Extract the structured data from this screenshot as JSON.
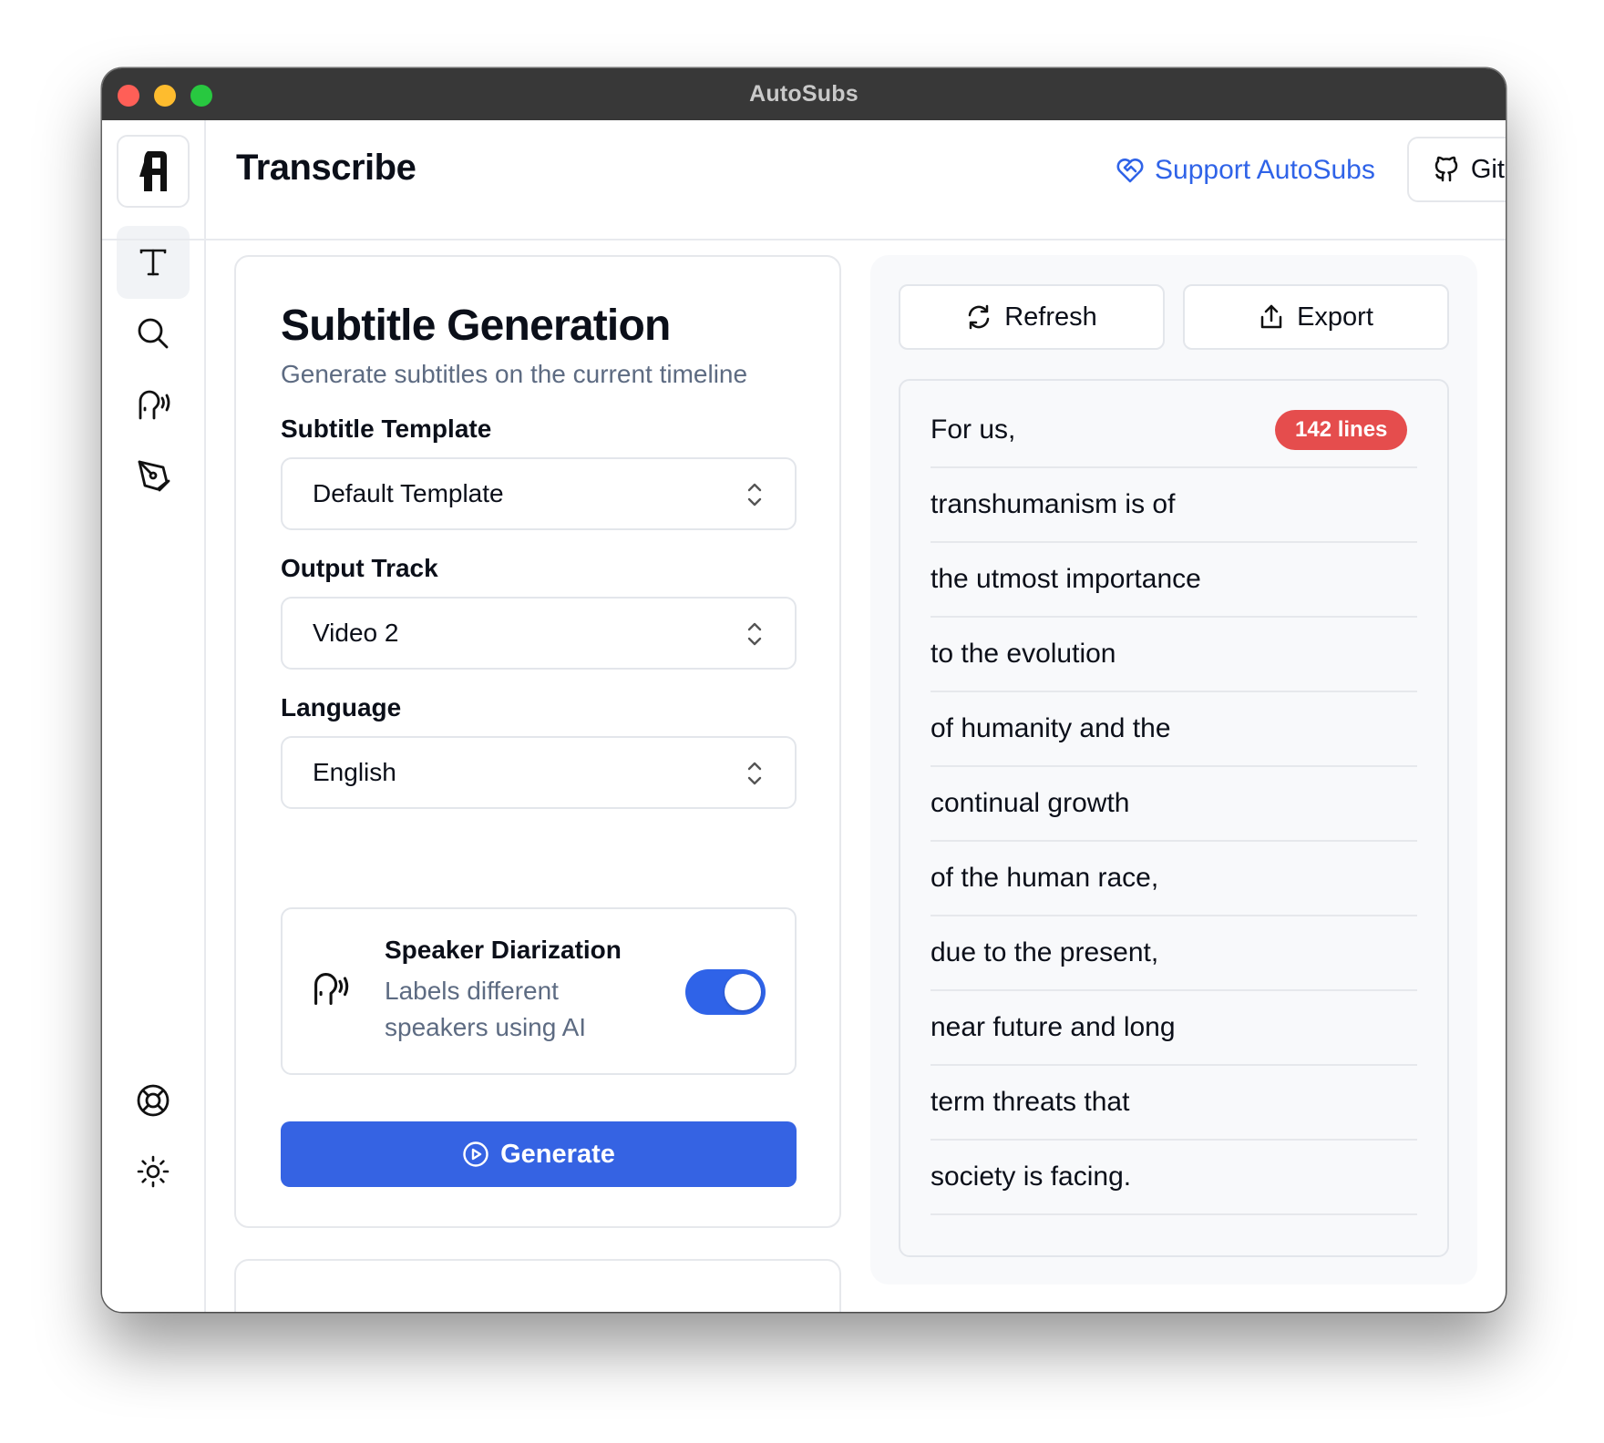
{
  "window": {
    "title": "AutoSubs"
  },
  "header": {
    "page_title": "Transcribe",
    "support_label": "Support AutoSubs",
    "github_label": "GitHub",
    "accent_color": "#2f63e8"
  },
  "sidebar": {
    "items": [
      {
        "name": "transcribe",
        "icon": "text-t-icon",
        "active": true
      },
      {
        "name": "search",
        "icon": "search-icon",
        "active": false
      },
      {
        "name": "speakers",
        "icon": "speaking-head-icon",
        "active": false
      },
      {
        "name": "edit",
        "icon": "pen-tool-icon",
        "active": false
      }
    ],
    "bottom_items": [
      {
        "name": "help",
        "icon": "lifebuoy-icon"
      },
      {
        "name": "theme",
        "icon": "sun-icon"
      }
    ]
  },
  "generation": {
    "title": "Subtitle Generation",
    "subtitle": "Generate subtitles on the current timeline",
    "template_label": "Subtitle Template",
    "template_value": "Default Template",
    "track_label": "Output Track",
    "track_value": "Video 2",
    "language_label": "Language",
    "language_value": "English",
    "diarization": {
      "title": "Speaker Diarization",
      "description": "Labels different speakers using AI",
      "enabled": true
    },
    "generate_label": "Generate",
    "button_color": "#3563e3"
  },
  "results": {
    "refresh_label": "Refresh",
    "export_label": "Export",
    "badge": "142 lines",
    "badge_color": "#e54d4d",
    "lines": [
      "For us,",
      "transhumanism is of",
      "the utmost importance",
      "to the evolution",
      "of humanity and the",
      "continual growth",
      "of the human race,",
      "due to the present,",
      "near future and long",
      "term threats that",
      "society is facing."
    ]
  }
}
